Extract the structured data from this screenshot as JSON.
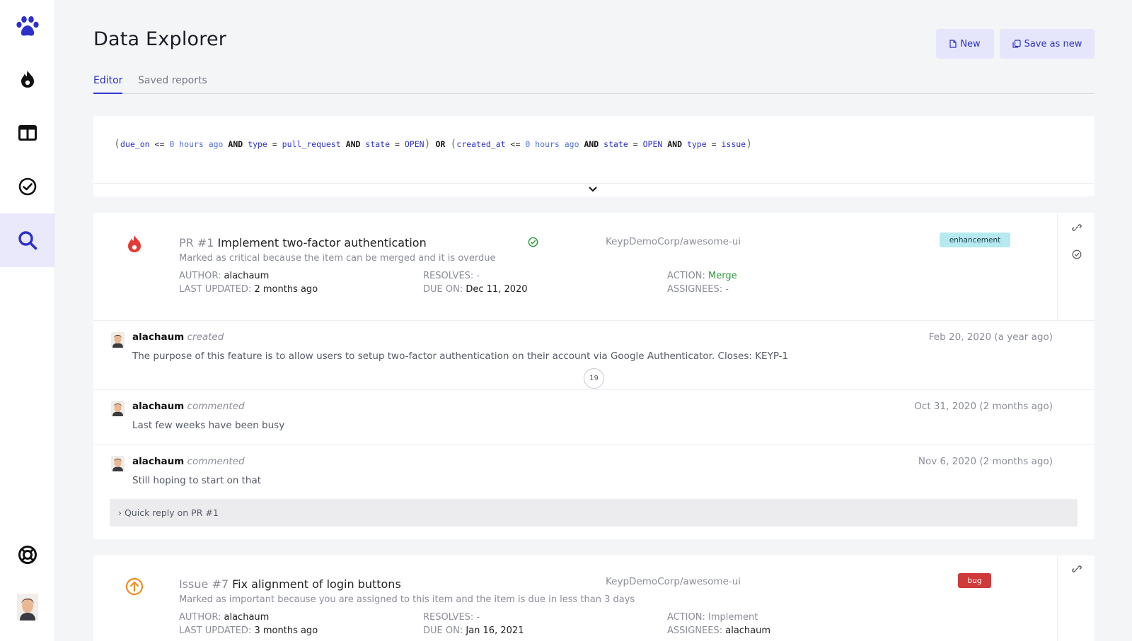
{
  "app": {
    "page_title": "Data Explorer",
    "new_label": "New",
    "save_as_new_label": "Save as new"
  },
  "sidebar": {
    "items": [
      {
        "name": "paw-logo-icon"
      },
      {
        "name": "flame-icon"
      },
      {
        "name": "board-icon"
      },
      {
        "name": "check-circle-icon"
      },
      {
        "name": "search-icon",
        "active": true
      },
      {
        "name": "lifebuoy-icon"
      },
      {
        "name": "user-avatar"
      }
    ]
  },
  "tabs": [
    {
      "label": "Editor",
      "active": true
    },
    {
      "label": "Saved reports",
      "active": false
    }
  ],
  "query": {
    "group1": {
      "f1": "due_on",
      "op1": "<=",
      "v1": "0 hours ago",
      "and1": "AND",
      "f2": "type",
      "op2": "=",
      "v2": "pull_request",
      "and2": "AND",
      "f3": "state",
      "op3": "=",
      "v3": "OPEN"
    },
    "or": "OR",
    "group2": {
      "f1": "created_at",
      "op1": "<=",
      "v1": "0 hours ago",
      "and1": "AND",
      "f2": "state",
      "op2": "=",
      "v2": "OPEN",
      "and2": "AND",
      "f3": "type",
      "op3": "=",
      "v3": "issue"
    }
  },
  "items": [
    {
      "ref": "PR #1",
      "title": "Implement two-factor authentication",
      "description": "Marked as critical because the item can be merged and it is overdue",
      "repo": "KeypDemoCorp/awesome-ui",
      "badge": "enhancement",
      "author_key": "AUTHOR",
      "author": "alachaum",
      "last_updated_key": "LAST UPDATED",
      "last_updated": "2 months ago",
      "resolves_key": "RESOLVES",
      "resolves": "-",
      "due_on_key": "DUE ON",
      "due_on": "Dec 11, 2020",
      "action_key": "ACTION",
      "action": "Merge",
      "assignees_key": "ASSIGNEES",
      "assignees": "-",
      "timeline": [
        {
          "author": "alachaum",
          "verb": "created",
          "date": "Feb 20, 2020 (a year ago)",
          "text": "The purpose of this feature is to allow users to setup two-factor authentication on their account via Google Authenticator. Closes: KEYP-1"
        },
        {
          "author": "alachaum",
          "verb": "commented",
          "date": "Oct 31, 2020 (2 months ago)",
          "text": "Last few weeks have been busy"
        },
        {
          "author": "alachaum",
          "verb": "commented",
          "date": "Nov 6, 2020 (2 months ago)",
          "text": "Still hoping to start on that"
        }
      ],
      "hidden_count": "19",
      "quick_reply": "› Quick reply on PR #1"
    },
    {
      "ref": "Issue #7",
      "title": "Fix alignment of login buttons",
      "description": "Marked as important because you are assigned to this item and the item is due in less than 3 days",
      "repo": "KeypDemoCorp/awesome-ui",
      "badge": "bug",
      "author_key": "AUTHOR",
      "author": "alachaum",
      "last_updated_key": "LAST UPDATED",
      "last_updated": "3 months ago",
      "resolves_key": "RESOLVES",
      "resolves": "-",
      "due_on_key": "DUE ON",
      "due_on": "Jan 16, 2021",
      "action_key": "ACTION",
      "action": "Implement",
      "assignees_key": "ASSIGNEES",
      "assignees": "alachaum"
    }
  ],
  "colors": {
    "accent": "#2d31c9",
    "accent_bg": "#e5e6fb",
    "merge_green": "#2f9a3c",
    "critical_red": "#e53935",
    "important_orange": "#f08c1e",
    "badge_enhancement": "#b7eaf0",
    "badge_bug": "#cf3a3a"
  }
}
